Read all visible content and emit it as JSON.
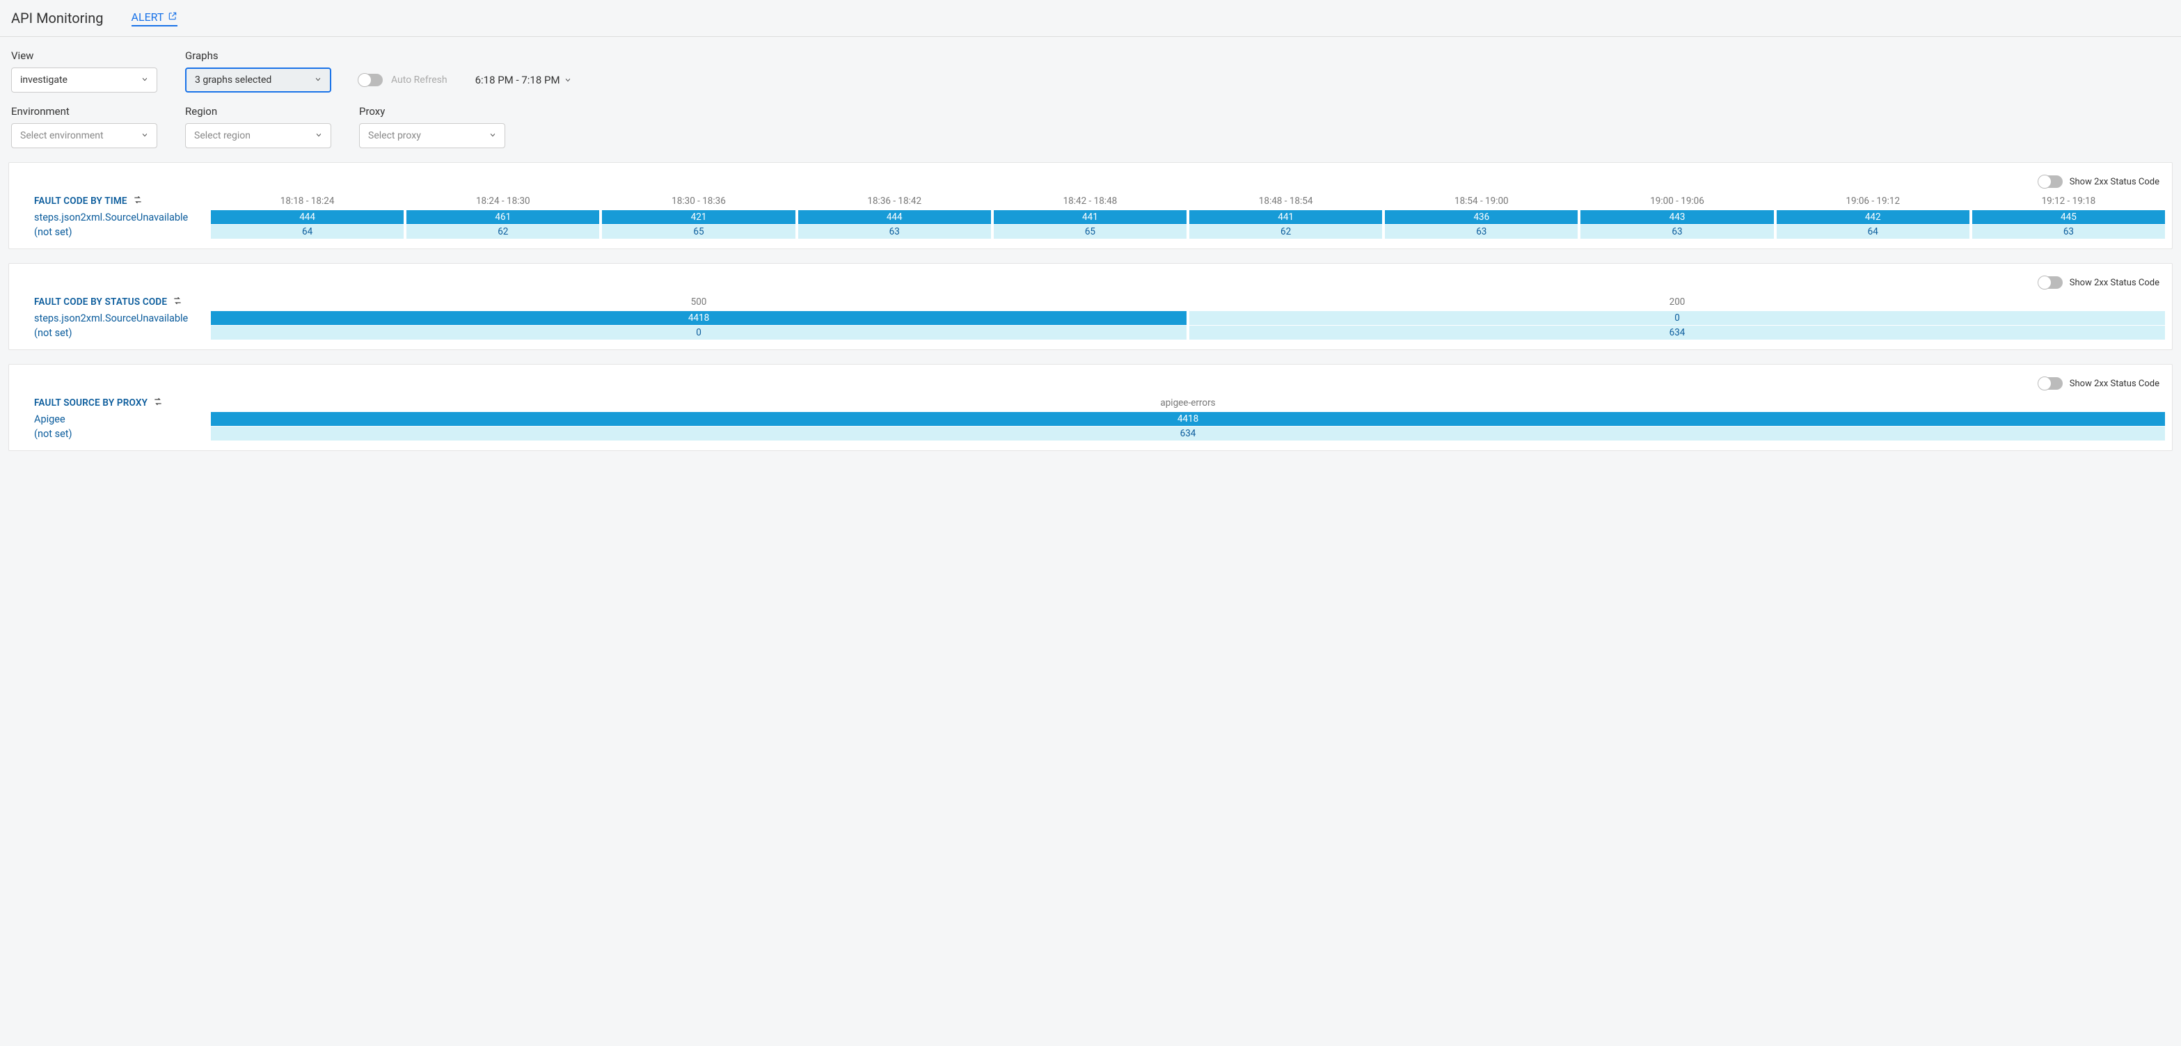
{
  "header": {
    "title": "API Monitoring",
    "alert_label": "ALERT"
  },
  "controls": {
    "view_label": "View",
    "view_value": "investigate",
    "graphs_label": "Graphs",
    "graphs_value": "3 graphs selected",
    "auto_refresh_label": "Auto Refresh",
    "time_range": "6:18 PM - 7:18 PM",
    "environment_label": "Environment",
    "environment_placeholder": "Select environment",
    "region_label": "Region",
    "region_placeholder": "Select region",
    "proxy_label": "Proxy",
    "proxy_placeholder": "Select proxy"
  },
  "show2xx_label": "Show 2xx Status Code",
  "panel_time": {
    "title": "FAULT CODE BY TIME",
    "row_labels": [
      "steps.json2xml.SourceUnavailable",
      "(not set)"
    ],
    "columns": [
      "18:18 - 18:24",
      "18:24 - 18:30",
      "18:30 - 18:36",
      "18:36 - 18:42",
      "18:42 - 18:48",
      "18:48 - 18:54",
      "18:54 - 19:00",
      "19:00 - 19:06",
      "19:06 - 19:12",
      "19:12 - 19:18"
    ],
    "rows": [
      [
        "444",
        "461",
        "421",
        "444",
        "441",
        "441",
        "436",
        "443",
        "442",
        "445"
      ],
      [
        "64",
        "62",
        "65",
        "63",
        "65",
        "62",
        "63",
        "63",
        "64",
        "63"
      ]
    ]
  },
  "panel_status": {
    "title": "FAULT CODE BY STATUS CODE",
    "row_labels": [
      "steps.json2xml.SourceUnavailable",
      "(not set)"
    ],
    "columns": [
      "500",
      "200"
    ],
    "rows": [
      [
        "4418",
        "0"
      ],
      [
        "0",
        "634"
      ]
    ]
  },
  "panel_proxy": {
    "title": "FAULT SOURCE BY PROXY",
    "row_labels": [
      "Apigee",
      "(not set)"
    ],
    "columns": [
      "apigee-errors"
    ],
    "rows": [
      [
        "4418"
      ],
      [
        "634"
      ]
    ]
  },
  "chart_data": [
    {
      "type": "heatmap",
      "title": "FAULT CODE BY TIME",
      "categories": [
        "18:18 - 18:24",
        "18:24 - 18:30",
        "18:30 - 18:36",
        "18:36 - 18:42",
        "18:42 - 18:48",
        "18:48 - 18:54",
        "18:54 - 19:00",
        "19:00 - 19:06",
        "19:06 - 19:12",
        "19:12 - 19:18"
      ],
      "series": [
        {
          "name": "steps.json2xml.SourceUnavailable",
          "values": [
            444,
            461,
            421,
            444,
            441,
            441,
            436,
            443,
            442,
            445
          ]
        },
        {
          "name": "(not set)",
          "values": [
            64,
            62,
            65,
            63,
            65,
            62,
            63,
            63,
            64,
            63
          ]
        }
      ]
    },
    {
      "type": "heatmap",
      "title": "FAULT CODE BY STATUS CODE",
      "categories": [
        "500",
        "200"
      ],
      "series": [
        {
          "name": "steps.json2xml.SourceUnavailable",
          "values": [
            4418,
            0
          ]
        },
        {
          "name": "(not set)",
          "values": [
            0,
            634
          ]
        }
      ]
    },
    {
      "type": "heatmap",
      "title": "FAULT SOURCE BY PROXY",
      "categories": [
        "apigee-errors"
      ],
      "series": [
        {
          "name": "Apigee",
          "values": [
            4418
          ]
        },
        {
          "name": "(not set)",
          "values": [
            634
          ]
        }
      ]
    }
  ]
}
